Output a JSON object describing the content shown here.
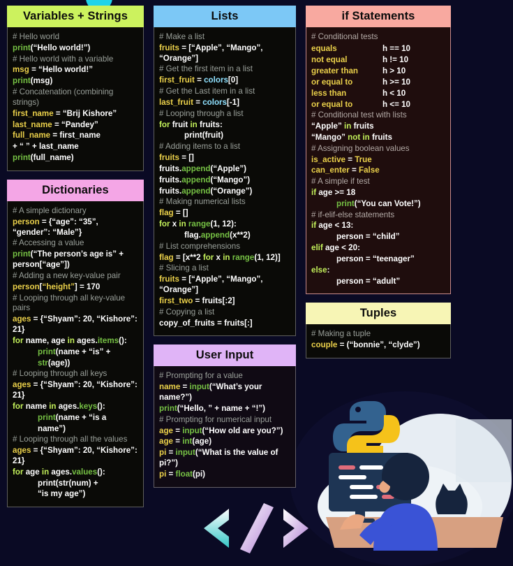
{
  "theme": {
    "background": "#0a0a24",
    "panel_default": "#0a0a07",
    "panel_maroon": "#1f0d0d",
    "title_green": "#ccf25e",
    "title_pink": "#f4a6e6",
    "title_blue": "#7cc8f6",
    "title_violet": "#e0b4f7",
    "title_salmon": "#f8a9a0",
    "title_cream": "#f7f5b5",
    "comment": "#9aa09a",
    "keyword": "#c3f05a",
    "function": "#76c144",
    "variable": "#ead04a",
    "builtin": "#8fe1ff",
    "text": "#ffffff"
  },
  "cards": {
    "variables_strings": {
      "title": "Variables + Strings",
      "lines": [
        "# Hello world",
        "print(“Hello world!”)",
        "# Hello world with a variable",
        "msg = “Hello world!”",
        "print(msg)",
        "# Concatenation (combining strings)",
        "first_name = “Brij Kishore”",
        "last_name = “Pandey”",
        "full_name = first_name",
        "+ “ ” + last_name",
        "print(full_name)"
      ]
    },
    "dictionaries": {
      "title": "Dictionaries",
      "lines": [
        "# A simple dictionary",
        "person = {“age”: “35”, “gender”: “Male”}",
        "# Accessing a value",
        "print(“The person’s age is” + person[“age”])",
        "# Adding a new key-value pair",
        "person[“height”] = 170",
        "# Looping through all key-value pairs",
        "ages = {“Shyam”: 20, “Kishore”: 21}",
        "for name, age in ages.items():",
        "print(name + “is” +",
        "str(age))",
        "# Looping through all keys",
        "ages = {“Shyam”: 20, “Kishore”: 21}",
        "for name in ages.keys():",
        "print(name + “is a",
        "name”)",
        "# Looping through all the values",
        "ages = {“Shyam”: 20, “Kishore”: 21}",
        "for age in ages.values():",
        "print(str(num) +",
        "“is my age”)"
      ]
    },
    "lists": {
      "title": "Lists",
      "lines": [
        "# Make a list",
        "fruits = [“Apple”, “Mango”, “Orange”]",
        "# Get the first item in a list",
        "first_fruit = colors[0]",
        "# Get the Last item in a list",
        "last_fruit = colors[-1]",
        "# Looping through a list",
        "for fruit in fruits:",
        "print(fruit)",
        "# Adding items to a list",
        "fruits = []",
        "fruits.append(“Apple”)",
        "fruits.append(“Mango”)",
        "fruits.append(“Orange”)",
        "# Making numerical lists",
        "flag = []",
        "for x in range(1, 12):",
        "flag.append(x**2)",
        "# List comprehensions",
        "flag = [x**2 for x in range(1, 12)]",
        "# Slicing a list",
        "fruits = [“Apple”, “Mango”, “Orange”]",
        "first_two = fruits[:2]",
        "# Copying a list",
        "copy_of_fruits = fruits[:]"
      ]
    },
    "user_input": {
      "title": "User Input",
      "lines": [
        "# Prompting for a value",
        "name = input(“What’s your name?”)",
        "print(“Hello, ” + name + “!”)",
        "# Prompting for numerical input",
        "age = input(“How old are you?”)",
        "age = int(age)",
        "pi = input(“What is the value of pi?”)",
        "pi = float(pi)"
      ]
    },
    "if_statements": {
      "title": "if Statements",
      "comment_tests": "# Conditional tests",
      "tests": [
        {
          "label": "equals",
          "expr": "h == 10"
        },
        {
          "label": "not equal",
          "expr": "h != 10"
        },
        {
          "label": "greater than",
          "expr": "h > 10"
        },
        {
          "label": "or equal to",
          "expr": "h >= 10"
        },
        {
          "label": "less than",
          "expr": "h < 10"
        },
        {
          "label": "or equal to",
          "expr": "h <= 10"
        }
      ],
      "lines": [
        "# Conditional test with lists",
        "“Apple” in fruits",
        "“Mango” not in fruits",
        "# Assigning boolean values",
        "is_active = True",
        "can_enter = False",
        "# A simple if test",
        "if age >= 18",
        "print(“You can Vote!”)",
        "# if-elif-else statements",
        "if age < 13:",
        "person = “child”",
        "elif age < 20:",
        "person = “teenager”",
        "else:",
        "person = “adult”"
      ]
    },
    "tuples": {
      "title": "Tuples",
      "lines": [
        "# Making a tuple",
        "couple = (“bonnie”, “clyde”)"
      ]
    }
  },
  "illustration": {
    "code_glyph": "code-brackets-glyph",
    "python_logo": "python-logo-icon",
    "person": "person-at-computer-illustration",
    "cat": "cat-illustration",
    "monitor": "monitor-illustration"
  }
}
